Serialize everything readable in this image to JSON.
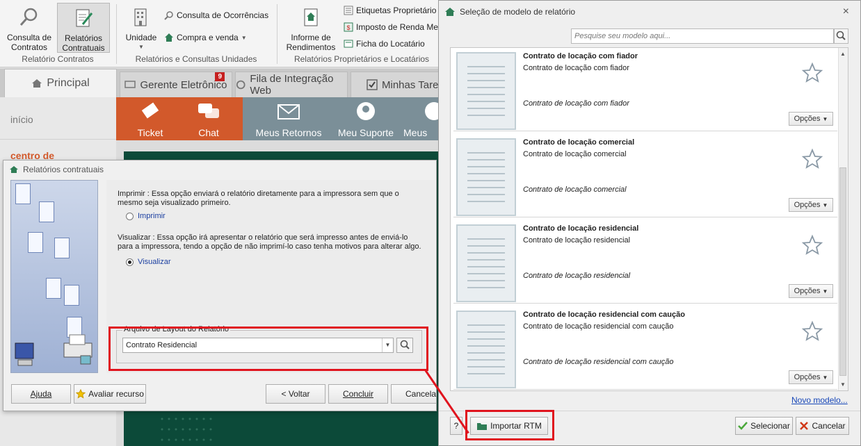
{
  "ribbon": {
    "consulta_contratos": "Consulta de\nContratos",
    "relatorios_contratuais": "Relatórios\nContratuais",
    "group_contratos": "Relatório Contratos",
    "unidade": "Unidade",
    "consulta_ocorrencias": "Consulta de Ocorrências",
    "compra_venda": "Compra e venda",
    "group_unidades": "Relatórios e Consultas Unidades",
    "informe_rendimentos": "Informe de\nRendimentos",
    "etiquetas": "Etiquetas Proprietário",
    "imposto_renda": "Imposto de Renda Me",
    "ficha_locatario": "Ficha do Locatário",
    "group_proprietarios": "Relatórios Proprietários e Locatários"
  },
  "tabs": [
    {
      "label": "Principal"
    },
    {
      "label": "Gerente Eletrônico",
      "badge": "9"
    },
    {
      "label": "Fila de Integração Web"
    },
    {
      "label": "Minhas Tare"
    }
  ],
  "portal": {
    "nav_inicio": "início",
    "nav_centro": "centro de",
    "tiles": [
      "Ticket",
      "Chat",
      "Meus Retornos",
      "Meu Suporte",
      "Meus Si"
    ],
    "colors": {
      "orange": "#d2592b",
      "gray": "#7b8f98",
      "green": "#0c4a39"
    }
  },
  "relatorios_dialog": {
    "title": "Relatórios contratuais",
    "imprimir_text": "Imprimir : Essa opção enviará o relatório diretamente para a impressora sem  que o mesmo seja visualizado primeiro.",
    "imprimir_label": "Imprimir",
    "visualizar_text": "Visualizar : Essa opção irá apresentar o relatório que será impresso antes de enviá-lo para a impressora, tendo a opção de não imprimí-lo caso tenha motivos para alterar algo.",
    "visualizar_label": "Visualizar",
    "selected_option": "Visualizar",
    "layout_legend": "Arquivo de Layout do Relatório",
    "layout_value": "Contrato Residencial",
    "btn_ajuda": "Ajuda",
    "btn_avaliar": "Avaliar recurso",
    "btn_voltar": "< Voltar",
    "btn_concluir": "Concluir",
    "btn_cancelar": "Cancelar"
  },
  "selecao_dialog": {
    "title": "Seleção de modelo de relatório",
    "close": "×",
    "search_placeholder": "Pesquise seu modelo aqui...",
    "models": [
      {
        "title": "Contrato de locação com fiador",
        "subtitle": "Contrato de locação com fiador",
        "description": "Contrato de locação com fiador",
        "options": "Opções"
      },
      {
        "title": "Contrato de locação comercial",
        "subtitle": "Contrato de locação comercial",
        "description": "Contrato de locação comercial",
        "options": "Opções"
      },
      {
        "title": "Contrato de locação residencial",
        "subtitle": "Contrato de locação residencial",
        "description": "Contrato de locação residencial",
        "options": "Opções"
      },
      {
        "title": "Contrato de locação residencial com caução",
        "subtitle": "Contrato de locação residencial com caução",
        "description": "Contrato de locação residencial com caução",
        "options": "Opções"
      }
    ],
    "novo_modelo": "Novo modelo...",
    "help": "?",
    "btn_importar": "Importar RTM",
    "btn_selecionar": "Selecionar",
    "btn_cancelar": "Cancelar",
    "highlight_color": "#e0141e"
  }
}
